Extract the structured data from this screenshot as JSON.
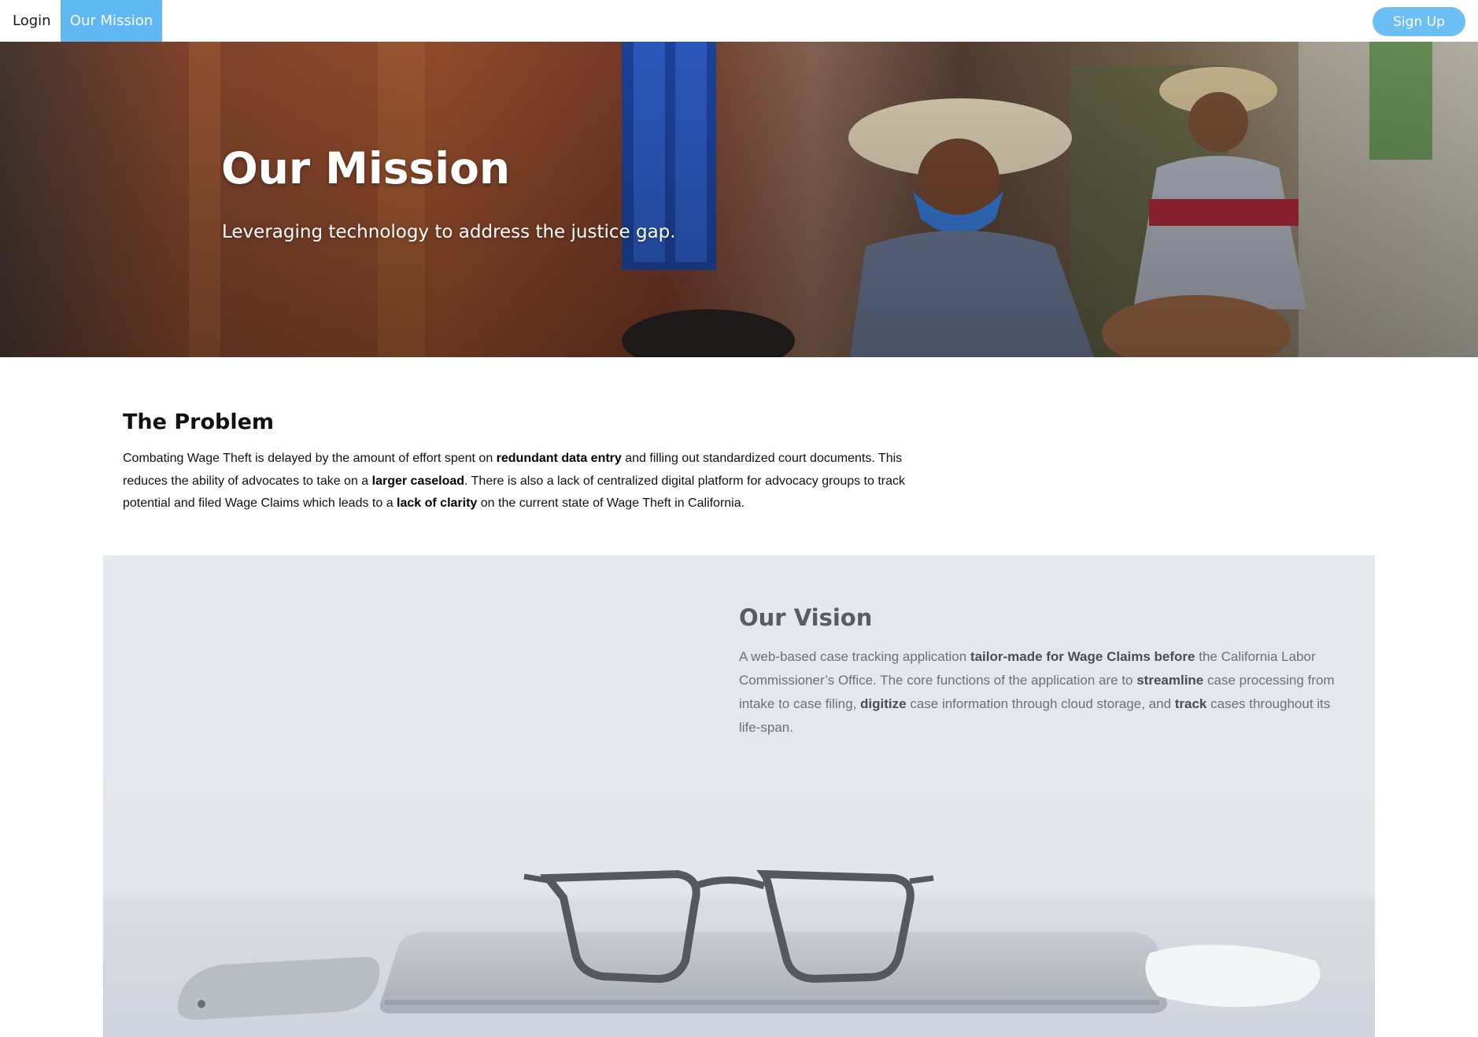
{
  "nav": {
    "login": "Login",
    "our_mission": "Our Mission",
    "sign_up": "Sign Up",
    "accent_color": "#5fb8f2"
  },
  "hero": {
    "title": "Our Mission",
    "subtitle": "Leveraging technology to address the justice gap."
  },
  "problem": {
    "heading": "The Problem",
    "t1": "Combating Wage Theft is delayed by the amount of effort spent on ",
    "b1": "redundant data entry",
    "t2": " and filling out standardized court documents. This reduces the ability of advocates to take on a ",
    "b2": "larger caseload",
    "t3": ". There is also a lack of centralized digital platform for advocacy groups to track potential and filed Wage Claims which leads to a ",
    "b3": "lack of clarity",
    "t4": " on the current state of Wage Theft in California."
  },
  "vision": {
    "heading": "Our Vision",
    "t1": "A web-based case tracking application ",
    "b1": "tailor-made for Wage Claims before",
    "t2": " the California Labor Commissioner’s Office. The core functions of the application are to ",
    "b2": "streamline",
    "t3": " case processing from intake to case filing, ",
    "b3": "digitize",
    "t4": " case information through cloud storage, and ",
    "b4": "track",
    "t5": " cases throughout its life-span."
  }
}
